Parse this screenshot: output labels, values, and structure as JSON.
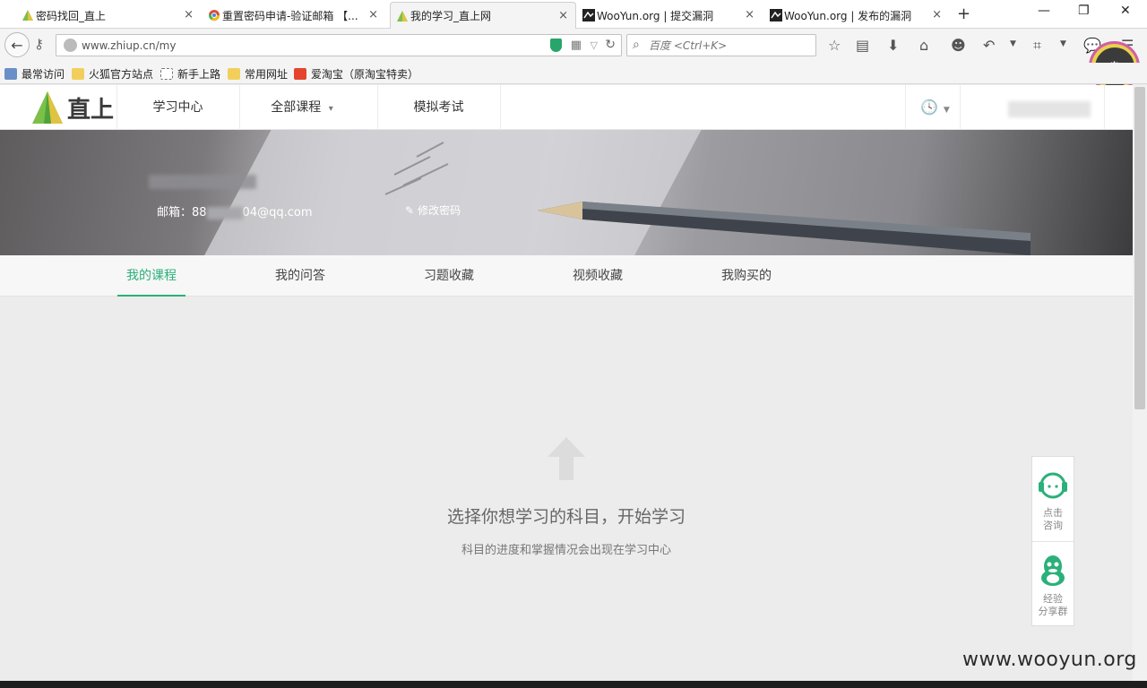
{
  "browser": {
    "tabs": [
      {
        "title": "密码找回_直上",
        "favicon": "zhishang-logo",
        "active": false
      },
      {
        "title": "重置密码申请-验证邮箱 【...",
        "favicon": "chrome-like-icon",
        "active": false
      },
      {
        "title": "我的学习_直上网",
        "favicon": "zhishang-logo",
        "active": true
      },
      {
        "title": "WooYun.org | 提交漏洞",
        "favicon": "wooyun-icon",
        "active": false
      },
      {
        "title": "WooYun.org | 发布的漏洞",
        "favicon": "wooyun-icon",
        "active": false
      }
    ],
    "tab_close": "×",
    "new_tab": "+",
    "window_controls": {
      "minimize": "—",
      "restore": "❐",
      "close": "✕"
    },
    "url": "www.zhiup.cn/my",
    "search_placeholder": "百度 <Ctrl+K>",
    "bookmarks": [
      {
        "label": "最常访问",
        "icon": "most-visited-icon"
      },
      {
        "label": "火狐官方站点",
        "icon": "folder-icon"
      },
      {
        "label": "新手上路",
        "icon": "page-icon"
      },
      {
        "label": "常用网址",
        "icon": "folder-icon"
      },
      {
        "label": "爱淘宝（原淘宝特卖）",
        "icon": "taobao-icon"
      }
    ]
  },
  "site": {
    "brand": "直上",
    "nav": [
      {
        "label": "学习中心"
      },
      {
        "label": "全部课程"
      },
      {
        "label": "模拟考试"
      }
    ],
    "nav_dropdown_arrow": "▾",
    "profile": {
      "email_prefix": "邮箱：88",
      "email_suffix": "04@qq.com",
      "change_password": "修改密码"
    },
    "subtabs": [
      {
        "label": "我的课程",
        "active": true
      },
      {
        "label": "我的问答",
        "active": false
      },
      {
        "label": "习题收藏",
        "active": false
      },
      {
        "label": "视频收藏",
        "active": false
      },
      {
        "label": "我购买的",
        "active": false
      }
    ],
    "empty_state": {
      "title": "选择你想学习的科目，开始学习",
      "subtitle": "科目的进度和掌握情况会出现在学习中心"
    },
    "side_widget": {
      "consult": "点击\n咨询",
      "group": "经验\n分享群"
    }
  },
  "watermark": "www.wooyun.org",
  "colors": {
    "accent": "#2bb07a",
    "logo_green": "#4caf50",
    "logo_yellow": "#e0c340"
  }
}
